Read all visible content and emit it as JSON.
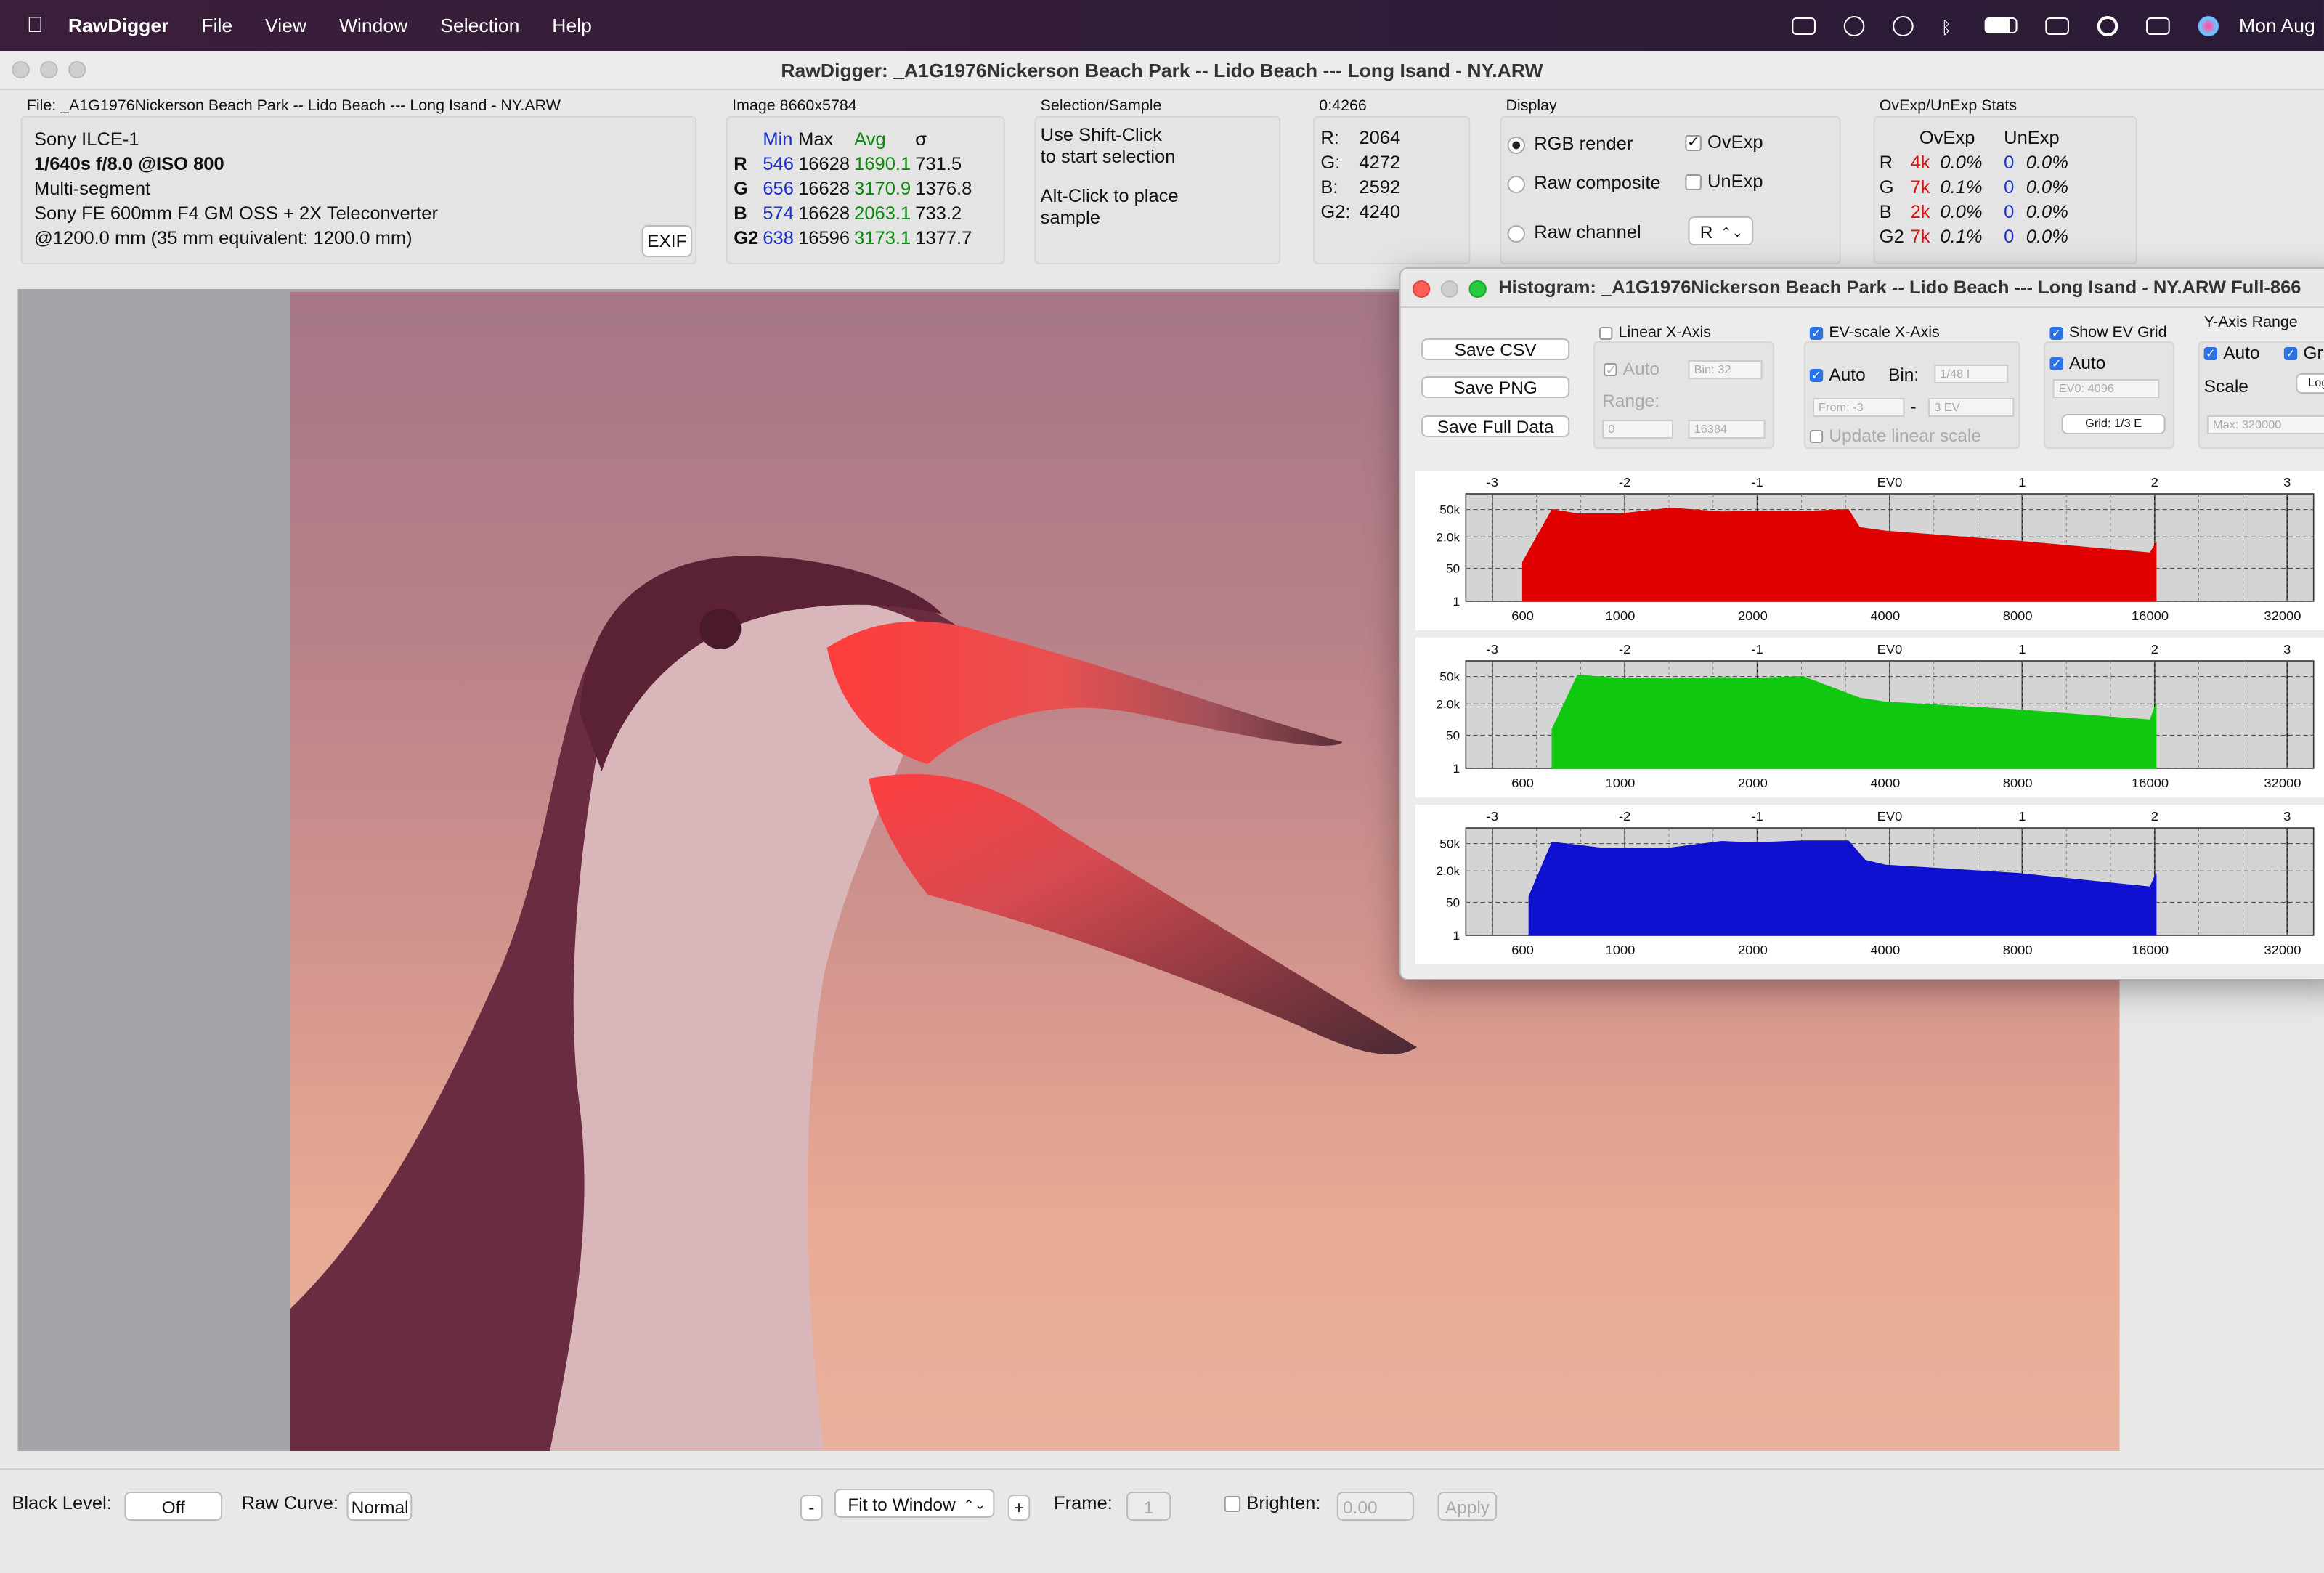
{
  "menubar": {
    "app": "RawDigger",
    "items": [
      "File",
      "View",
      "Window",
      "Selection",
      "Help"
    ],
    "clock": "Mon Aug"
  },
  "window": {
    "title": "RawDigger: _A1G1976Nickerson Beach Park -- Lido Beach --- Long Isand - NY.ARW"
  },
  "file": {
    "label": "File: _A1G1976Nickerson Beach Park -- Lido Beach --- Long Isand - NY.ARW",
    "camera": "Sony ILCE-1",
    "exposure": "1/640s f/8.0 @ISO 800",
    "metering": "Multi-segment",
    "lens": "Sony FE 600mm F4 GM OSS + 2X Teleconverter",
    "focal": "@1200.0 mm (35 mm equivalent: 1200.0 mm)",
    "exif_button": "EXIF"
  },
  "image": {
    "label": "Image 8660x5784",
    "headers": [
      "Min",
      "Max",
      "Avg",
      "σ"
    ],
    "rows": [
      {
        "ch": "R",
        "min": "546",
        "max": "16628",
        "avg": "1690.1",
        "sd": "731.5"
      },
      {
        "ch": "G",
        "min": "656",
        "max": "16628",
        "avg": "3170.9",
        "sd": "1376.8"
      },
      {
        "ch": "B",
        "min": "574",
        "max": "16628",
        "avg": "2063.1",
        "sd": "733.2"
      },
      {
        "ch": "G2",
        "min": "638",
        "max": "16596",
        "avg": "3173.1",
        "sd": "1377.7"
      }
    ]
  },
  "selection": {
    "label": "Selection/Sample",
    "line1": "Use Shift-Click",
    "line2": "to start selection",
    "line3": "Alt-Click to place",
    "line4": "sample"
  },
  "sample": {
    "label": "0:4266",
    "rows": [
      {
        "ch": "R:",
        "v": "2064"
      },
      {
        "ch": "G:",
        "v": "4272"
      },
      {
        "ch": "B:",
        "v": "2592"
      },
      {
        "ch": "G2:",
        "v": "4240"
      }
    ]
  },
  "display": {
    "label": "Display",
    "rgb": "RGB render",
    "raw_comp": "Raw composite",
    "raw_ch": "Raw channel",
    "ovexp": "OvExp",
    "unexp": "UnExp",
    "channel": "R"
  },
  "ovstats": {
    "label": "OvExp/UnExp Stats",
    "h1": "OvExp",
    "h2": "UnExp",
    "rows": [
      {
        "ch": "R",
        "ov": "4k",
        "ovp": "0.0%",
        "un": "0",
        "unp": "0.0%"
      },
      {
        "ch": "G",
        "ov": "7k",
        "ovp": "0.1%",
        "un": "0",
        "unp": "0.0%"
      },
      {
        "ch": "B",
        "ov": "2k",
        "ovp": "0.0%",
        "un": "0",
        "unp": "0.0%"
      },
      {
        "ch": "G2",
        "ov": "7k",
        "ovp": "0.1%",
        "un": "0",
        "unp": "0.0%"
      }
    ]
  },
  "histwin": {
    "title": "Histogram: _A1G1976Nickerson Beach Park -- Lido Beach --- Long Isand - NY.ARW Full-866",
    "save_csv": "Save CSV",
    "save_png": "Save PNG",
    "save_full": "Save Full Data",
    "linear": "Linear X-Axis",
    "auto": "Auto",
    "bin": "Bin: 32",
    "range": "Range:",
    "r_from": "0",
    "r_to": "16384",
    "ev_scale": "EV-scale X-Axis",
    "ev_auto": "Auto",
    "ev_bin": "Bin:",
    "ev_binv": "1/48 I",
    "from": "From: -3",
    "to": "3 EV",
    "update": "Update linear scale",
    "show_grid": "Show EV Grid",
    "grid_auto": "Auto",
    "ev0": "EV0: 4096",
    "grid": "Grid: 1/3 E",
    "yrange": "Y-Axis Range",
    "y_auto": "Auto",
    "y_gr": "Gr",
    "scale": "Scale",
    "log": "Log",
    "max": "Max: 320000"
  },
  "bottom": {
    "black_level": "Black Level:",
    "black_val": "Off",
    "raw_curve": "Raw Curve:",
    "curve_val": "Normal",
    "minus": "-",
    "fit": "Fit to Window",
    "plus": "+",
    "frame": "Frame:",
    "frame_val": "1",
    "brighten": "Brighten:",
    "bright_val": "0.00",
    "apply": "Apply"
  },
  "chart_data": {
    "type": "area",
    "xscale": "log2",
    "x_ticks": [
      "600",
      "1000",
      "2000",
      "4000",
      "8000",
      "16000",
      "32000"
    ],
    "ev_ticks": [
      "-3",
      "-2",
      "-1",
      "EV0",
      "1",
      "2",
      "3"
    ],
    "y_ticks": [
      "50k",
      "2.0k",
      "50",
      "1"
    ],
    "series": [
      {
        "color": "#e00000",
        "x": [
          600,
          700,
          800,
          1000,
          1300,
          1700,
          2000,
          2600,
          3300,
          3500,
          4000,
          8000,
          16000,
          16500
        ],
        "y": [
          100,
          50000,
          30000,
          30000,
          60000,
          38000,
          40000,
          40000,
          50000,
          6000,
          4000,
          1200,
          300,
          1000
        ]
      },
      {
        "color": "#10c810",
        "x": [
          700,
          800,
          1000,
          1300,
          1700,
          2000,
          2600,
          3500,
          4000,
          8000,
          16000,
          16500
        ],
        "y": [
          100,
          60000,
          40000,
          38000,
          45000,
          40000,
          50000,
          4000,
          2500,
          1000,
          300,
          2000
        ]
      },
      {
        "color": "#1010d0",
        "x": [
          620,
          700,
          900,
          1300,
          1700,
          2000,
          2600,
          3300,
          3600,
          4000,
          8000,
          16000,
          16500
        ],
        "y": [
          100,
          60000,
          30000,
          30000,
          65000,
          55000,
          70000,
          70000,
          7000,
          4000,
          1500,
          300,
          1500
        ]
      }
    ]
  }
}
